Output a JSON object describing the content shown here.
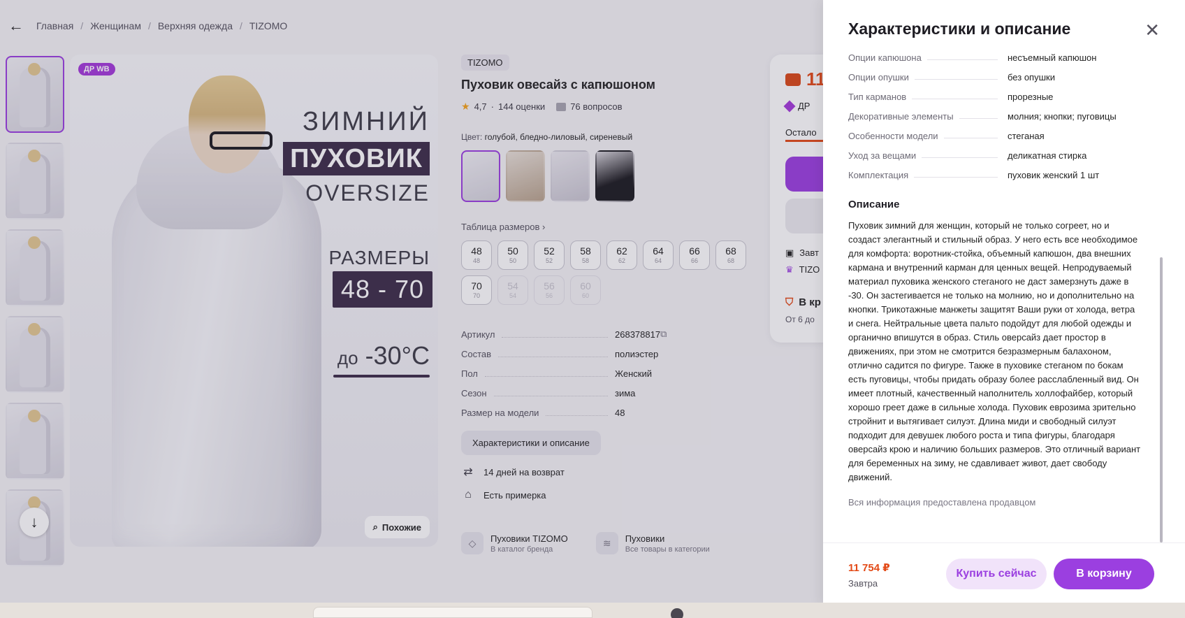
{
  "breadcrumb": {
    "back_icon": "arrow-left-icon",
    "items": [
      "Главная",
      "Женщинам",
      "Верхняя одежда",
      "TIZOMO"
    ],
    "separator": "/"
  },
  "gallery": {
    "badge": "ДР WB",
    "promo": {
      "line1": "ЗИМНИЙ",
      "line2": "ПУХОВИК",
      "line3": "OVERSIZE",
      "sizes_title": "РАЗМЕРЫ",
      "sizes_range": "48 - 70",
      "temp_prefix": "до",
      "temp_value": "-30°C"
    },
    "similar_button": "Похожие",
    "thumbnails_count": 6,
    "scroll_down_icon": "arrow-down-icon"
  },
  "product": {
    "brand": "TIZOMO",
    "title": "Пуховик овесайз с капюшоном",
    "rating": "4,7",
    "rating_count": "144 оценки",
    "questions": "76 вопросов",
    "color_label": "Цвет:",
    "color_value": "голубой, бледно-лиловый, сиреневый",
    "size_table_link": "Таблица размеров",
    "sizes": [
      {
        "main": "48",
        "sub": "48",
        "available": true
      },
      {
        "main": "50",
        "sub": "50",
        "available": true
      },
      {
        "main": "52",
        "sub": "52",
        "available": true
      },
      {
        "main": "58",
        "sub": "58",
        "available": true
      },
      {
        "main": "62",
        "sub": "62",
        "available": true
      },
      {
        "main": "64",
        "sub": "64",
        "available": true
      },
      {
        "main": "66",
        "sub": "66",
        "available": true
      },
      {
        "main": "68",
        "sub": "68",
        "available": true
      },
      {
        "main": "70",
        "sub": "70",
        "available": true
      },
      {
        "main": "54",
        "sub": "54",
        "available": false
      },
      {
        "main": "56",
        "sub": "56",
        "available": false
      },
      {
        "main": "60",
        "sub": "60",
        "available": false
      }
    ],
    "specs": [
      {
        "k": "Артикул",
        "v": "268378817"
      },
      {
        "k": "Состав",
        "v": "полиэстер"
      },
      {
        "k": "Пол",
        "v": "Женский"
      },
      {
        "k": "Сезон",
        "v": "зима"
      },
      {
        "k": "Размер на модели",
        "v": "48"
      }
    ],
    "chars_button": "Характеристики и описание",
    "features": [
      {
        "icon": "return-arrows-icon",
        "text": "14 дней на возврат"
      },
      {
        "icon": "hanger-icon",
        "text": "Есть примерка"
      }
    ],
    "category_links": [
      {
        "icon": "tag-icon",
        "title": "Пуховики TIZOMO",
        "subtitle": "В каталог бренда"
      },
      {
        "icon": "layers-icon",
        "title": "Пуховики",
        "subtitle": "Все товары в категории"
      }
    ]
  },
  "buy_card": {
    "price_partial": "11",
    "dr_partial": "ДР",
    "left_partial": "Остало",
    "line1_partial": "Завт",
    "line2_partial": "TIZO",
    "line3_partial": "В кр",
    "line4_partial": "От 6 до"
  },
  "panel": {
    "title": "Характеристики и описание",
    "close_icon": "close-icon",
    "rows": [
      {
        "k": "Опции капюшона",
        "v": "несъемный капюшон"
      },
      {
        "k": "Опции опушки",
        "v": "без опушки"
      },
      {
        "k": "Тип карманов",
        "v": "прорезные"
      },
      {
        "k": "Декоративные элементы",
        "v": "молния; кнопки; пуговицы"
      },
      {
        "k": "Особенности модели",
        "v": "стеганая"
      },
      {
        "k": "Уход за вещами",
        "v": "деликатная стирка"
      },
      {
        "k": "Комплектация",
        "v": "пуховик женский 1 шт"
      }
    ],
    "description_title": "Описание",
    "description": "Пуховик зимний для женщин, который не только согреет, но и создаст элегантный и стильный образ. У него есть все необходимое для комфорта: воротник-стойка, объемный капюшон, два внешних кармана и внутренний карман для ценных вещей. Непродуваемый материал пуховика женского стеганого не даст замерзнуть даже в -30. Он застегивается не только на молнию, но и дополнительно на кнопки. Трикотажные манжеты защитят Ваши руки от холода, ветра и снега. Нейтральные цвета пальто подойдут для любой одежды и органично впишутся в образ. Стиль оверсайз дает простор в движениях, при этом не смотрится безразмерным балахоном, отлично садится по фигуре. Также в пуховике стеганом по бокам есть пуговицы, чтобы придать образу более расслабленный вид. Он имеет плотный, качественный наполнитель холлофайбер, который хорошо греет даже в сильные холода. Пуховик еврозима зрительно стройнит и вытягивает силуэт. Длина миди и свободный силуэт подходит для девушек любого роста и типа фигуры, благодаря оверсайз крою и наличию больших размеров. Это отличный вариант для беременных на зиму, не сдавливает живот, дает свободу движений.",
    "note": "Вся информация предоставлена продавцом",
    "footer": {
      "price": "11 754 ₽",
      "delivery": "Завтра",
      "buy_now": "Купить сейчас",
      "add_to_cart": "В корзину"
    }
  },
  "colors": {
    "accent": "#9b3fe0",
    "price": "#e34a17",
    "badge": "#a43ad9"
  }
}
